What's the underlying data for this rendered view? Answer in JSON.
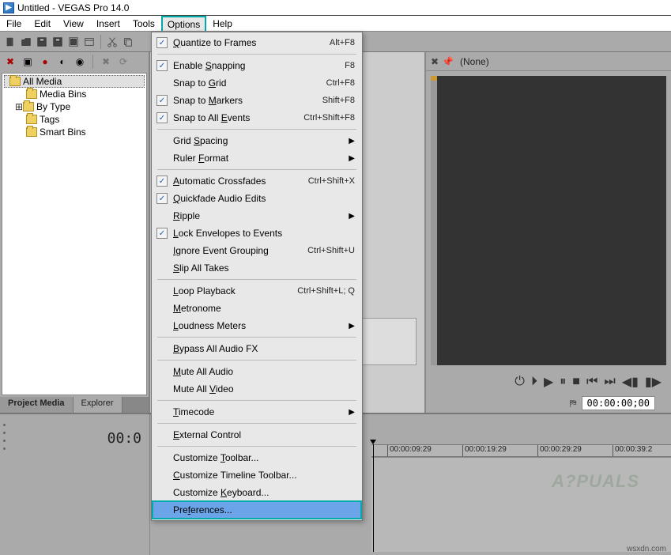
{
  "title": "Untitled - VEGAS Pro 14.0",
  "menubar": [
    "File",
    "Edit",
    "View",
    "Insert",
    "Tools",
    "Options",
    "Help"
  ],
  "menubar_open_index": 5,
  "left_panel": {
    "tree": [
      {
        "label": "All Media",
        "selected": true,
        "indent": 0
      },
      {
        "label": "Media Bins",
        "indent": 1
      },
      {
        "label": "By Type",
        "indent": 1,
        "expandable": true
      },
      {
        "label": "Tags",
        "indent": 1
      },
      {
        "label": "Smart Bins",
        "indent": 1
      }
    ],
    "tabs": [
      "Project Media",
      "Explorer"
    ],
    "active_tab": 0
  },
  "preview": {
    "label": "(None)",
    "timecode": "00:00:00;00"
  },
  "timeline": {
    "track_time": "00:0",
    "ruler": [
      "00:00:09:29",
      "00:00:19:29",
      "00:00:29:29",
      "00:00:39:2"
    ]
  },
  "options_menu": [
    {
      "type": "item",
      "label": "Quantize to Frames",
      "u": 0,
      "checked": true,
      "shortcut": "Alt+F8"
    },
    {
      "type": "sep"
    },
    {
      "type": "item",
      "label": "Enable Snapping",
      "u": 7,
      "checked": true,
      "shortcut": "F8"
    },
    {
      "type": "item",
      "label": "Snap to Grid",
      "u": 8,
      "shortcut": "Ctrl+F8"
    },
    {
      "type": "item",
      "label": "Snap to Markers",
      "u": 8,
      "checked": true,
      "shortcut": "Shift+F8"
    },
    {
      "type": "item",
      "label": "Snap to All Events",
      "u": 12,
      "checked": true,
      "shortcut": "Ctrl+Shift+F8"
    },
    {
      "type": "sep"
    },
    {
      "type": "item",
      "label": "Grid Spacing",
      "u": 5,
      "submenu": true
    },
    {
      "type": "item",
      "label": "Ruler Format",
      "u": 6,
      "submenu": true
    },
    {
      "type": "sep"
    },
    {
      "type": "item",
      "label": "Automatic Crossfades",
      "u": 0,
      "checked": true,
      "shortcut": "Ctrl+Shift+X"
    },
    {
      "type": "item",
      "label": "Quickfade Audio Edits",
      "u": 0,
      "checked": true
    },
    {
      "type": "item",
      "label": "Ripple",
      "u": 0,
      "submenu": true
    },
    {
      "type": "item",
      "label": "Lock Envelopes to Events",
      "u": 0,
      "checked": true
    },
    {
      "type": "item",
      "label": "Ignore Event Grouping",
      "u": 0,
      "shortcut": "Ctrl+Shift+U"
    },
    {
      "type": "item",
      "label": "Slip All Takes",
      "u": 0
    },
    {
      "type": "sep"
    },
    {
      "type": "item",
      "label": "Loop Playback",
      "u": 0,
      "shortcut": "Ctrl+Shift+L; Q"
    },
    {
      "type": "item",
      "label": "Metronome",
      "u": 0
    },
    {
      "type": "item",
      "label": "Loudness Meters",
      "u": 0,
      "submenu": true
    },
    {
      "type": "sep"
    },
    {
      "type": "item",
      "label": "Bypass All Audio FX",
      "u": 0
    },
    {
      "type": "sep"
    },
    {
      "type": "item",
      "label": "Mute All Audio",
      "u": 0
    },
    {
      "type": "item",
      "label": "Mute All Video",
      "u": 9
    },
    {
      "type": "sep"
    },
    {
      "type": "item",
      "label": "Timecode",
      "u": 0,
      "submenu": true
    },
    {
      "type": "sep"
    },
    {
      "type": "item",
      "label": "External Control",
      "u": 0
    },
    {
      "type": "sep"
    },
    {
      "type": "item",
      "label": "Customize Toolbar...",
      "u": 10
    },
    {
      "type": "item",
      "label": "Customize Timeline Toolbar...",
      "u": 0
    },
    {
      "type": "item",
      "label": "Customize Keyboard...",
      "u": 10
    },
    {
      "type": "item",
      "label": "Preferences...",
      "u": 3,
      "highlight": true
    }
  ],
  "watermark": "A?PUALS",
  "footer": "wsxdn.com"
}
